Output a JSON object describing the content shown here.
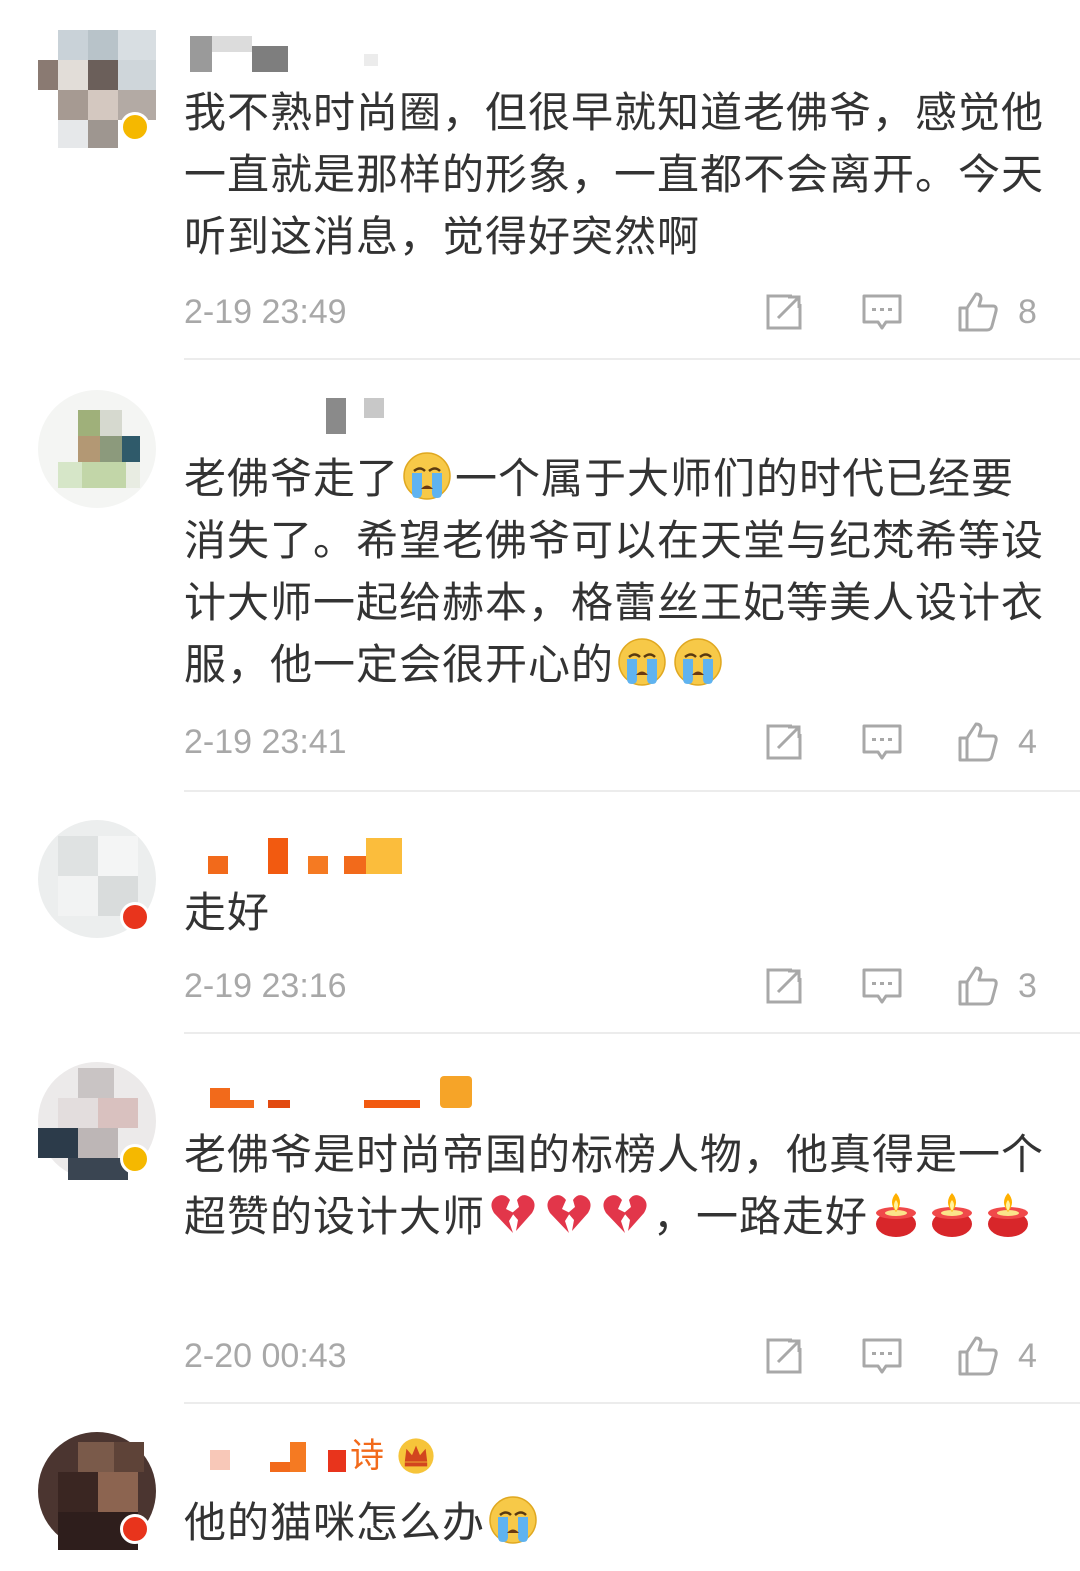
{
  "comments": [
    {
      "text": "我不熟时尚圈，但很早就知道老佛爷，感觉他一直就是那样的形象，一直都不会离开。今天听到这消息，觉得好突然啊",
      "time": "2-19 23:49",
      "likes": "8",
      "badge_color": "#f5b800"
    },
    {
      "text_a": "老佛爷走了",
      "text_b": "一个属于大师们的时代已经要消失了。希望老佛爷可以在天堂与纪梵希等设计大师一起给赫本，格蕾丝王妃等美人设计衣服，他一定会很开心的",
      "time": "2-19 23:41",
      "likes": "4",
      "emojis": [
        "crying-emoji",
        "crying-emoji",
        "crying-emoji"
      ]
    },
    {
      "text": "走好",
      "time": "2-19 23:16",
      "likes": "3",
      "badge_color": "#e8341c"
    },
    {
      "text_a": "老佛爷是时尚帝国的标榜人物，他真得是一个超赞的设计大师",
      "text_b": "，一路走好",
      "time": "2-20 00:43",
      "likes": "4",
      "badge_color": "#f5b800",
      "emojis": [
        "broken-heart-emoji",
        "broken-heart-emoji",
        "broken-heart-emoji",
        "candle-emoji",
        "candle-emoji",
        "candle-emoji"
      ]
    },
    {
      "name_glyph": "诗",
      "text": "他的猫咪怎么办",
      "badge_color": "#e8341c",
      "emojis": [
        "crown-badge-icon",
        "crying-emoji"
      ]
    }
  ],
  "colors": {
    "text": "#333333",
    "meta": "#a8a8a8",
    "divider": "#ececec",
    "icon": "#a8a8a8"
  },
  "icons": {
    "forward": "forward-icon",
    "reply": "reply-icon",
    "like": "thumbs-up-icon"
  }
}
